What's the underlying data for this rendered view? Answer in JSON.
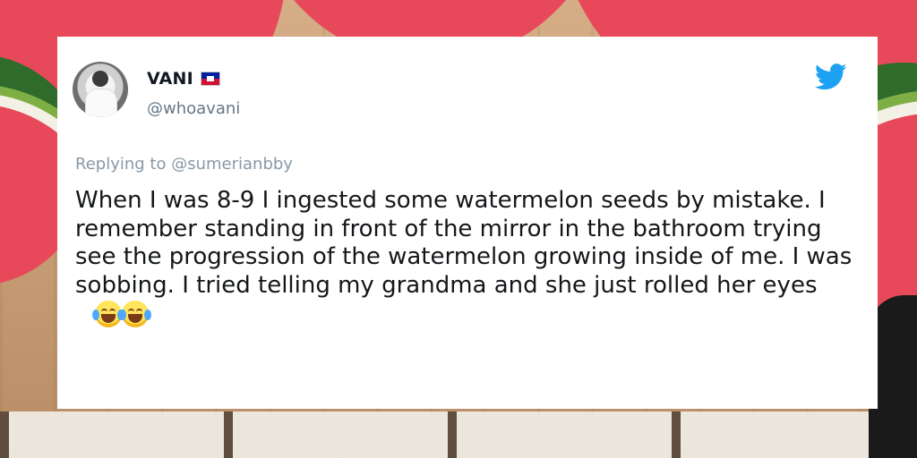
{
  "tweet": {
    "display_name": "VANI",
    "handle": "@whoavani",
    "reply_prefix": "Replying to",
    "reply_to": "@sumerianbby",
    "text": "When I was 8-9 I ingested some watermelon seeds by mistake. I remember standing in front of the mirror in the bathroom trying see the progression of the watermelon growing inside of me. I was sobbing. I tried telling my grandma and she just rolled her eyes",
    "emojis": [
      "face-with-tears-of-joy-icon",
      "face-with-tears-of-joy-icon"
    ]
  },
  "colors": {
    "twitter_blue": "#1da1f2",
    "handle_gray": "#657786",
    "text": "#14171a"
  },
  "icons": {
    "flag": "haiti-flag-icon",
    "brand": "twitter-bird-icon"
  }
}
